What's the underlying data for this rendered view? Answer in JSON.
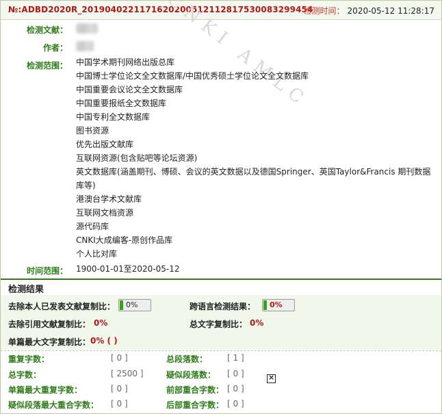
{
  "header": {
    "report_no": "№:ADBD2020R_20190402211716202005121128175300832994­54",
    "check_time_label": "检测时间：",
    "check_time_value": "2020-05-12 11:28:17"
  },
  "meta": {
    "doc_label": "检测文献：",
    "author_label": "作者：",
    "scope_label": "检测范围：",
    "scope_items": [
      "中国学术期刊网络出版总库",
      "中国博士学位论文全文数据库/中国优秀硕士学位论文全文数据库",
      "中国重要会议论文全文数据库",
      "中国重要报纸全文数据库",
      "中国专利全文数据库",
      "图书资源",
      "优先出版文献库",
      "互联网资源(包含贴吧等论坛资源)",
      "英文数据库(涵盖期刊、博硕、会议的英文数据以及德国Springer、英国Taylor&Francis 期刊数据库等)",
      "港澳台学术文献库",
      "互联网文档资源",
      "源代码库",
      "CNKI大成编客-原创作品库",
      "个人比对库"
    ],
    "time_label": "时间范围：",
    "time_value": "1900-01-01至2020-05-12"
  },
  "results": {
    "title": "检测结果",
    "self_excl_label": "去除本人已发表文献复制比：",
    "self_excl_value": "0%",
    "self_excl_percent": 0,
    "cross_lang_label": "跨语言检测结果：",
    "cross_lang_value": "0%",
    "cross_lang_percent": 0,
    "cite_excl_label": "去除引用文献复制比：",
    "cite_excl_value": "0%",
    "total_copy_label": "总文字复制比：",
    "total_copy_value": "0%",
    "single_max_label": "单篇最大文字复制比：",
    "single_max_value": "0%  (  )"
  },
  "stats": {
    "repeat_chars_label": "重复字数：",
    "repeat_chars_value": "[ 0 ]",
    "total_paras_label": "总段落数：",
    "total_paras_value": "[ 1 ]",
    "total_chars_label": "总字数：",
    "total_chars_value": "[ 2500 ]",
    "suspect_paras_label": "疑似段落数：",
    "suspect_paras_value": "[ 0 ]",
    "single_max_repeat_label": "单篇最大重复字数：",
    "single_max_repeat_value": "[ 0 ]",
    "front_overlap_label": "前部重合字数：",
    "front_overlap_value": "[ 0 ]",
    "suspect_max_overlap_label": "疑似段落最大重合字数：",
    "suspect_max_overlap_value": "[ 0 ]",
    "back_overlap_label": "后部重合字数：",
    "back_overlap_value": "[ 0 ]"
  },
  "colors": {
    "accent_green": "#2f7d1a",
    "alert_red": "#b01818",
    "panel_bg": "#f2f7ec"
  }
}
